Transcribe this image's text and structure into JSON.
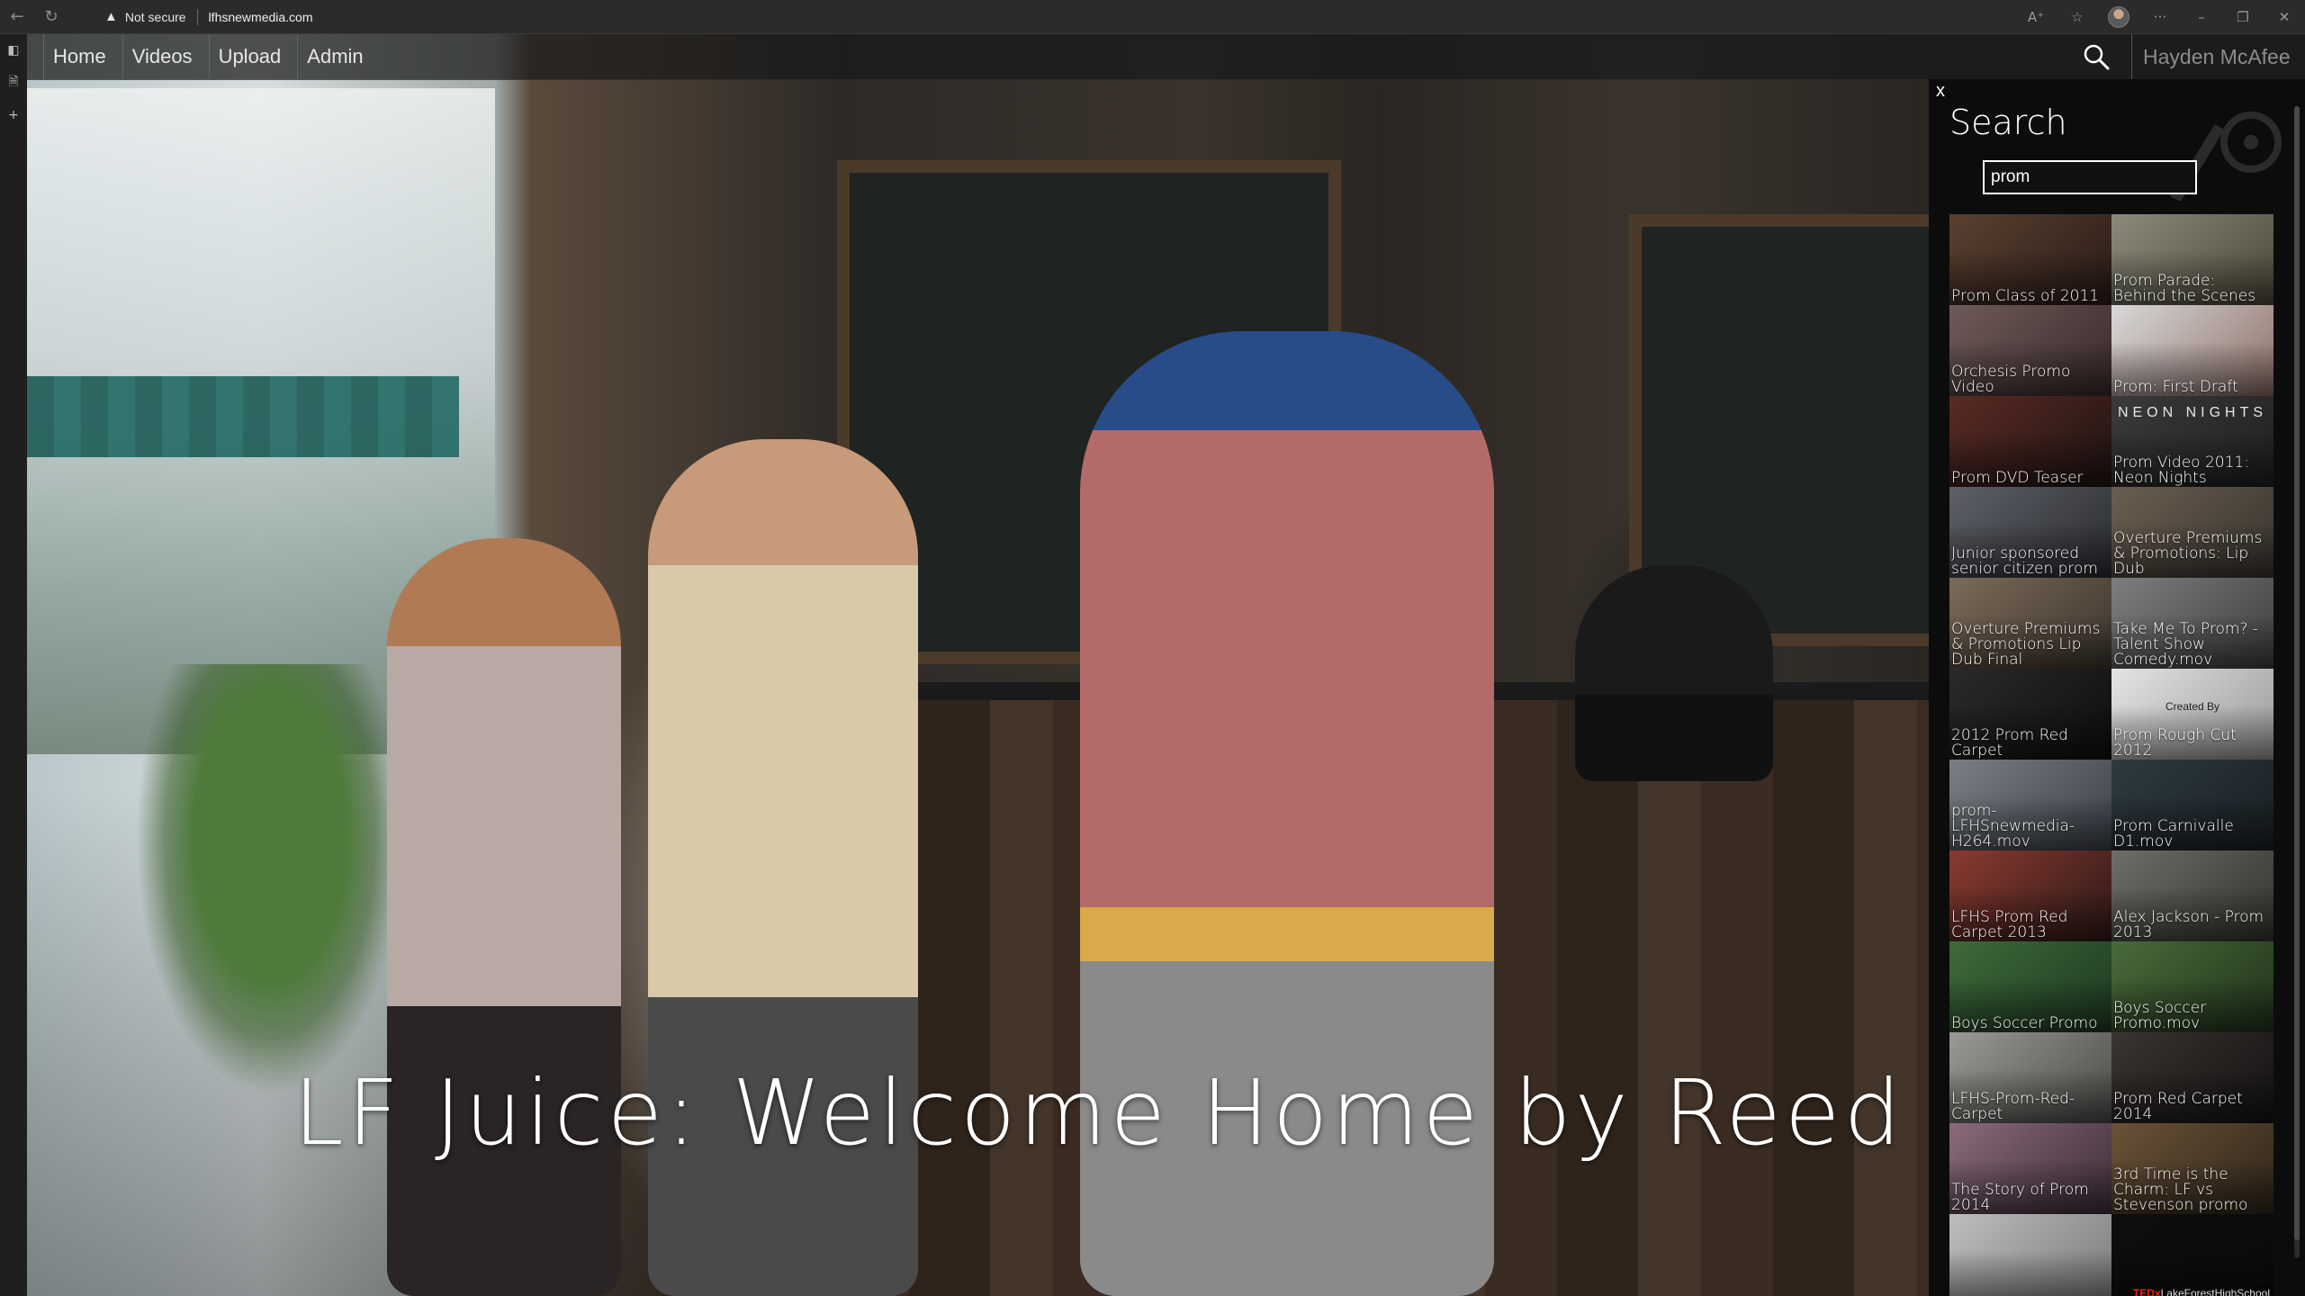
{
  "browser": {
    "security_text": "Not secure",
    "url": "lfhsnewmedia.com"
  },
  "nav": {
    "items": [
      "Home",
      "Videos",
      "Upload",
      "Admin"
    ],
    "user_name": "Hayden McAfee"
  },
  "hero": {
    "title": "LF Juice: Welcome Home by Reed Cl"
  },
  "search": {
    "close_label": "x",
    "heading": "Search",
    "query": "prom",
    "results": [
      {
        "label": "Prom Class of 2011",
        "colors": [
          "#5a4030",
          "#2a1c18"
        ]
      },
      {
        "label": "Prom Parade: Behind the Scenes",
        "colors": [
          "#8a8a7a",
          "#4e4a3a"
        ]
      },
      {
        "label": "Orchesis Promo Video",
        "colors": [
          "#6e5a58",
          "#3a2a2c"
        ]
      },
      {
        "label": "Prom: First Draft",
        "colors": [
          "#d8d8d8",
          "#8e7068"
        ]
      },
      {
        "label": "Prom DVD Teaser",
        "colors": [
          "#5a2a24",
          "#1e1412"
        ]
      },
      {
        "label": "Prom Video 2011: Neon Nights",
        "colors": [
          "#3a3a3a",
          "#202020"
        ],
        "overlay": "NEON NIGHTS"
      },
      {
        "label": "Junior sponsored senior citizen prom",
        "colors": [
          "#5e6068",
          "#2a2c30"
        ]
      },
      {
        "label": "Overture Premiums & Promotions: Lip Dub",
        "colors": [
          "#6a5e50",
          "#3a342e"
        ]
      },
      {
        "label": "Overture Premiums & Promotions Lip Dub Final",
        "colors": [
          "#7a6a58",
          "#3e362e"
        ]
      },
      {
        "label": "Take Me To Prom? -Talent Show Comedy.mov",
        "colors": [
          "#7e7e80",
          "#3e3e40"
        ]
      },
      {
        "label": "2012 Prom Red Carpet",
        "colors": [
          "#2a2a2a",
          "#0e0e0e"
        ]
      },
      {
        "label": "Prom Rough Cut 2012",
        "colors": [
          "#e4e4e4",
          "#9a9a9a"
        ],
        "overlay": "Created By"
      },
      {
        "label": "prom-LFHSnewmedia-H264.mov",
        "colors": [
          "#7a7e86",
          "#3c4048"
        ]
      },
      {
        "label": "Prom Carnivalle D1.mov",
        "colors": [
          "#2e3a40",
          "#182024"
        ]
      },
      {
        "label": "LFHS Prom Red Carpet 2013",
        "colors": [
          "#8a3a30",
          "#2e1a18"
        ]
      },
      {
        "label": "Alex Jackson - Prom 2013",
        "colors": [
          "#6e6e68",
          "#34342e"
        ]
      },
      {
        "label": "Boys Soccer Promo",
        "colors": [
          "#3e6a3a",
          "#1e3a22"
        ]
      },
      {
        "label": "Boys Soccer Promo.mov",
        "colors": [
          "#4a6a3a",
          "#20341c"
        ]
      },
      {
        "label": "LFHS-Prom-Red-Carpet",
        "colors": [
          "#9a9a94",
          "#4a4c48"
        ]
      },
      {
        "label": "Prom Red Carpet 2014",
        "colors": [
          "#3a3432",
          "#141212"
        ]
      },
      {
        "label": "The Story of Prom 2014",
        "colors": [
          "#8a6a7a",
          "#3e2e3a"
        ]
      },
      {
        "label": "3rd Time is the Charm: LF vs Stevenson promo",
        "colors": [
          "#6a5238",
          "#30261a"
        ]
      },
      {
        "label": "",
        "colors": [
          "#bdbdbd",
          "#7a7a7a"
        ]
      },
      {
        "label": "",
        "colors": [
          "#0e0e0e",
          "#0a0a0a"
        ],
        "logo_red": "TEDx",
        "logo": "LakeForestHighSchool"
      }
    ]
  },
  "colors": {
    "nav_bg": "#191919",
    "panel_bg": "#0c0c0c",
    "user_name": "#8c8c8c"
  }
}
